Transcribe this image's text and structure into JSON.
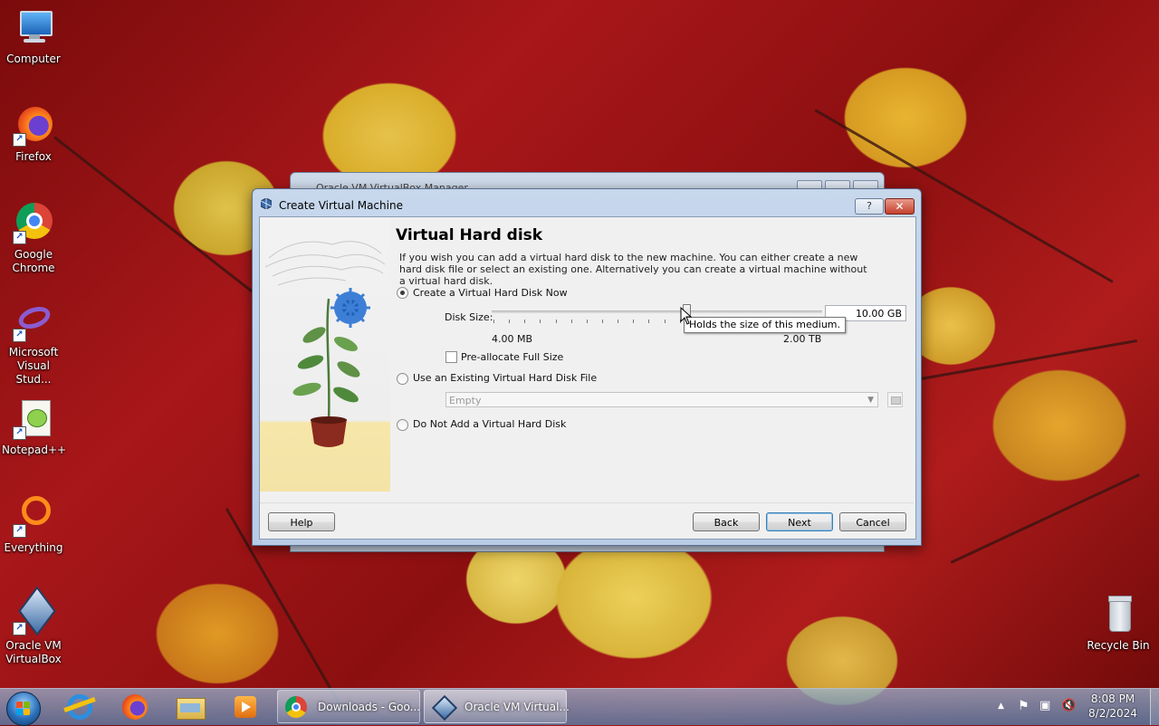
{
  "desktop": {
    "icons": [
      {
        "label": "Computer",
        "icon": "computer-icon"
      },
      {
        "label": "Firefox",
        "icon": "firefox-icon"
      },
      {
        "label": "Google Chrome",
        "icon": "chrome-icon"
      },
      {
        "label": "Microsoft Visual Stud...",
        "icon": "visual-studio-icon"
      },
      {
        "label": "Notepad++",
        "icon": "notepadpp-icon"
      },
      {
        "label": "Everything",
        "icon": "everything-icon"
      },
      {
        "label": "Oracle VM VirtualBox",
        "icon": "virtualbox-icon"
      },
      {
        "label": "Recycle Bin",
        "icon": "recycle-bin-icon"
      }
    ]
  },
  "background_window": {
    "title": "Oracle VM VirtualBox Manager"
  },
  "dialog": {
    "title": "Create Virtual Machine",
    "help_glyph": "?",
    "close_glyph": "✕",
    "heading": "Virtual Hard disk",
    "description": "If you wish you can add a virtual hard disk to the new machine. You can either create a new hard disk file or select an existing one. Alternatively you can create a virtual machine without a virtual hard disk.",
    "options": {
      "create_now": "Create a Virtual Hard Disk Now",
      "use_existing": "Use an Existing Virtual Hard Disk File",
      "do_not_add": "Do Not Add a Virtual Hard Disk",
      "selected": "create_now"
    },
    "disk_size": {
      "label": "Disk Size:",
      "value": "10.00 GB",
      "min_label": "4.00 MB",
      "max_label": "2.00 TB",
      "slider_position": 0.59
    },
    "tooltip": "Holds the size of this medium.",
    "preallocate": {
      "label": "Pre-allocate Full Size",
      "checked": false
    },
    "existing_file": {
      "value": "Empty"
    },
    "buttons": {
      "help": "Help",
      "back": "Back",
      "next": "Next",
      "cancel": "Cancel"
    }
  },
  "taskbar": {
    "pinned": [
      "internet-explorer-icon",
      "firefox-icon",
      "file-explorer-icon",
      "media-player-icon"
    ],
    "tasks": [
      {
        "label": "Downloads - Goo...",
        "icon": "chrome-icon"
      },
      {
        "label": "Oracle VM Virtual...",
        "icon": "virtualbox-icon"
      }
    ],
    "tray": {
      "icons": [
        "show-hidden-icons-arrow",
        "action-center-flag-icon",
        "network-icon",
        "volume-muted-icon"
      ],
      "time": "8:08 PM",
      "date": "8/2/2024"
    }
  }
}
